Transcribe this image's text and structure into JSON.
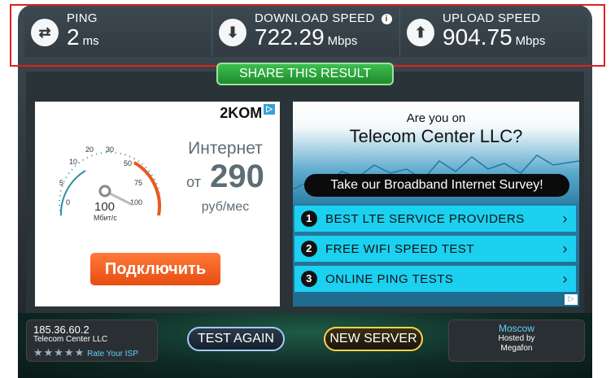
{
  "stats": {
    "ping": {
      "label": "PING",
      "value": "2",
      "unit": "ms",
      "icon": "swap-arrows-icon"
    },
    "download": {
      "label": "DOWNLOAD SPEED",
      "value": "722.29",
      "unit": "Mbps",
      "icon": "arrow-down-icon"
    },
    "upload": {
      "label": "UPLOAD SPEED",
      "value": "904.75",
      "unit": "Mbps",
      "icon": "arrow-up-icon"
    },
    "info_glyph": "i"
  },
  "share_label": "SHARE THIS RESULT",
  "ad_left": {
    "logo": "2KOM",
    "adchoice": "▷",
    "title": "Интернет",
    "price_prefix": "от",
    "price": "290",
    "unit": "руб/мес",
    "gauge_ticks": [
      "0",
      "5",
      "10",
      "20",
      "30",
      "50",
      "75",
      "100"
    ],
    "gauge_value": "100",
    "gauge_unit": "Мбит/с",
    "connect_label": "Подключить"
  },
  "ad_right": {
    "question": "Are you on",
    "isp": "Telecom Center LLC?",
    "survey": "Take our Broadband Internet Survey!",
    "items": [
      {
        "num": "1",
        "label": "BEST LTE SERVICE PROVIDERS"
      },
      {
        "num": "2",
        "label": "FREE WIFI SPEED TEST"
      },
      {
        "num": "3",
        "label": "ONLINE PING TESTS"
      }
    ],
    "adchoice": "▷"
  },
  "isp": {
    "ip": "185.36.60.2",
    "name": "Telecom Center LLC",
    "stars": "★★★★★",
    "rate_label": "Rate Your ISP"
  },
  "buttons": {
    "test_again": "TEST AGAIN",
    "new_server": "NEW SERVER"
  },
  "server": {
    "city": "Moscow",
    "hosted_by": "Hosted by",
    "host": "Megafon"
  },
  "colors": {
    "highlight": "#e02020",
    "share_green": "#2aa83a",
    "connect_orange": "#f05a1a",
    "list_cyan": "#1cd0f0"
  }
}
